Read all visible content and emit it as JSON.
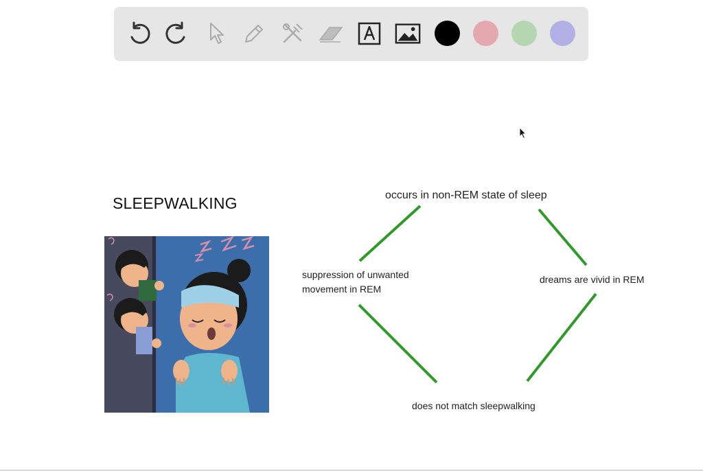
{
  "toolbar": {
    "tools": [
      {
        "name": "undo-icon"
      },
      {
        "name": "redo-icon"
      },
      {
        "name": "select-pointer-icon"
      },
      {
        "name": "pencil-icon"
      },
      {
        "name": "tools-icon"
      },
      {
        "name": "eraser-icon"
      },
      {
        "name": "text-box-icon"
      },
      {
        "name": "image-icon"
      }
    ],
    "colors": [
      "#000000",
      "#e4a9ae",
      "#b4d6b0",
      "#b3b0e6"
    ]
  },
  "canvas": {
    "title": "SLEEPWALKING",
    "diagram": {
      "top": "occurs in non-REM state of sleep",
      "left": "suppression of unwanted movement in REM",
      "right": "dreams are vivid in REM",
      "bottom": "does not match sleepwalking",
      "line_color": "#2f9a2a"
    }
  }
}
